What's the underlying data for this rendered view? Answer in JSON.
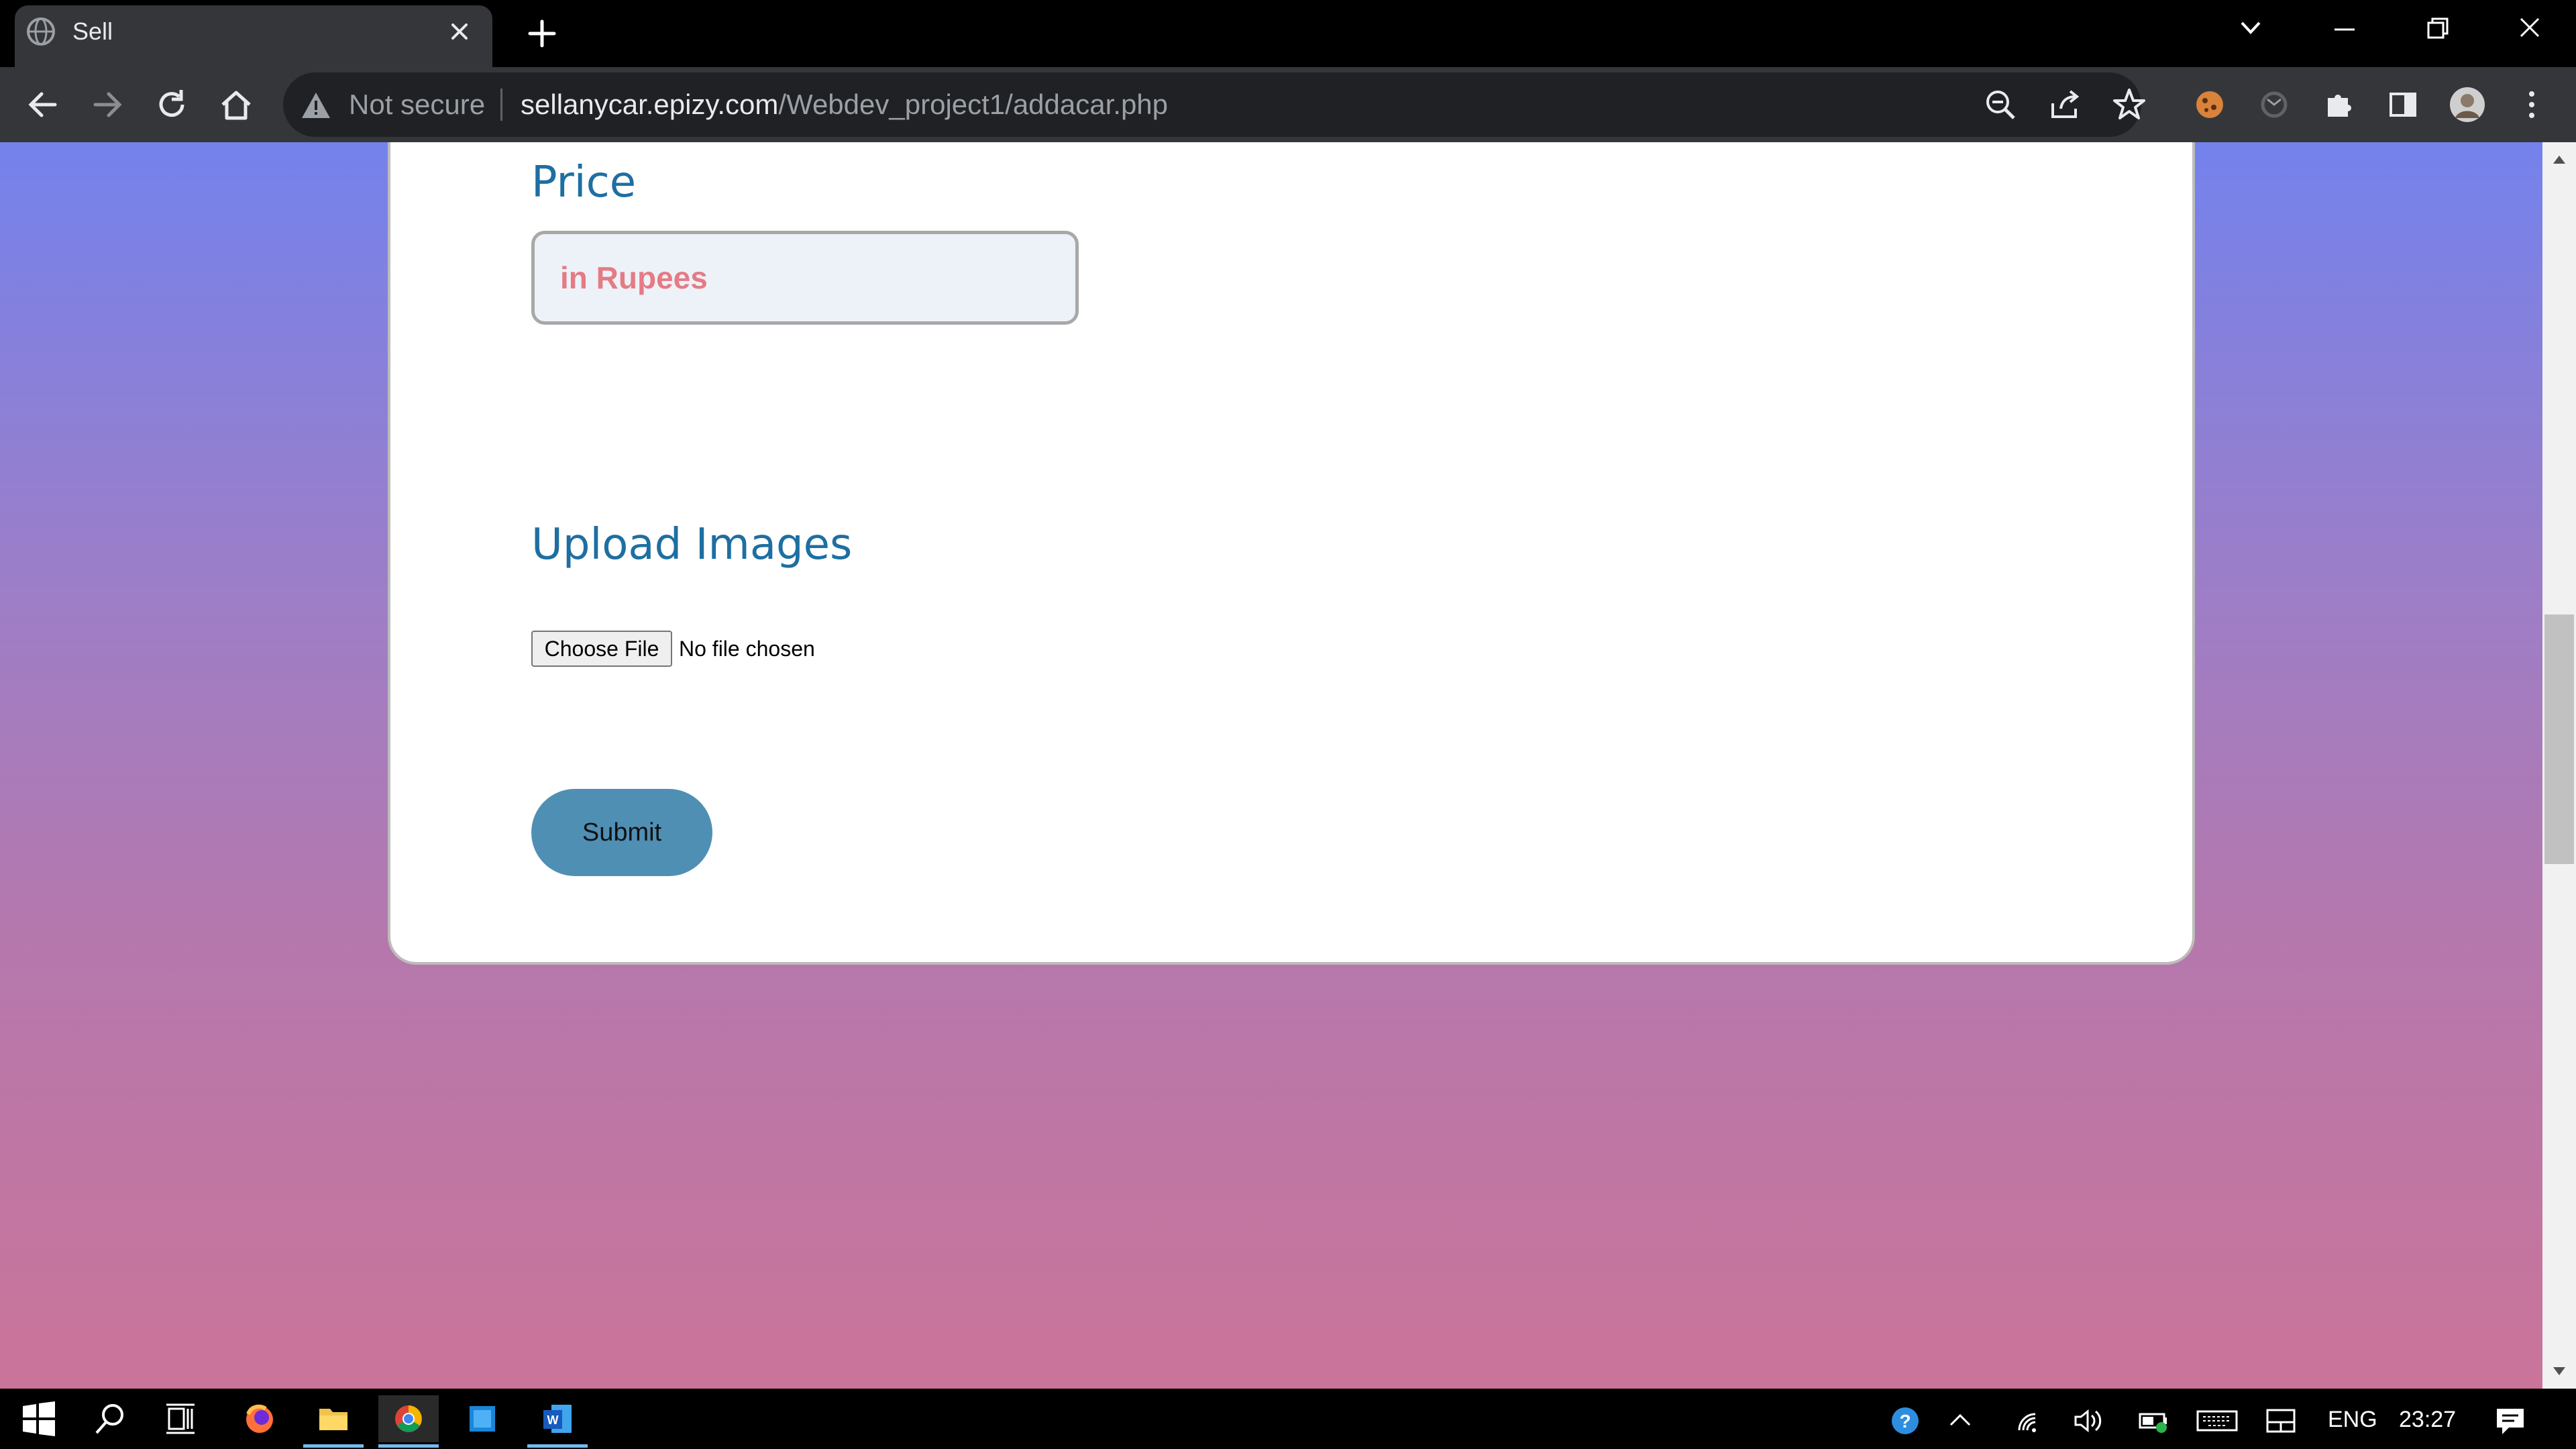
{
  "browser": {
    "tab": {
      "title": "Sell"
    },
    "address_bar": {
      "security_label": "Not secure",
      "url_host": "sellanycar.epizy.com",
      "url_path": "/Webdev_project1/addacar.php"
    }
  },
  "page": {
    "price": {
      "label": "Price",
      "placeholder": "in Rupees"
    },
    "upload": {
      "label": "Upload Images",
      "choose_file_label": "Choose File",
      "no_file_text": "No file chosen"
    },
    "submit_label": "Submit"
  },
  "taskbar": {
    "language": "ENG",
    "time": "23:27"
  },
  "colors": {
    "heading": "#1e6fa1",
    "placeholder": "#e57b85",
    "submit_bg": "#4f8fb4",
    "gradient_top": "#7482ec",
    "gradient_bottom": "#ca7499"
  }
}
